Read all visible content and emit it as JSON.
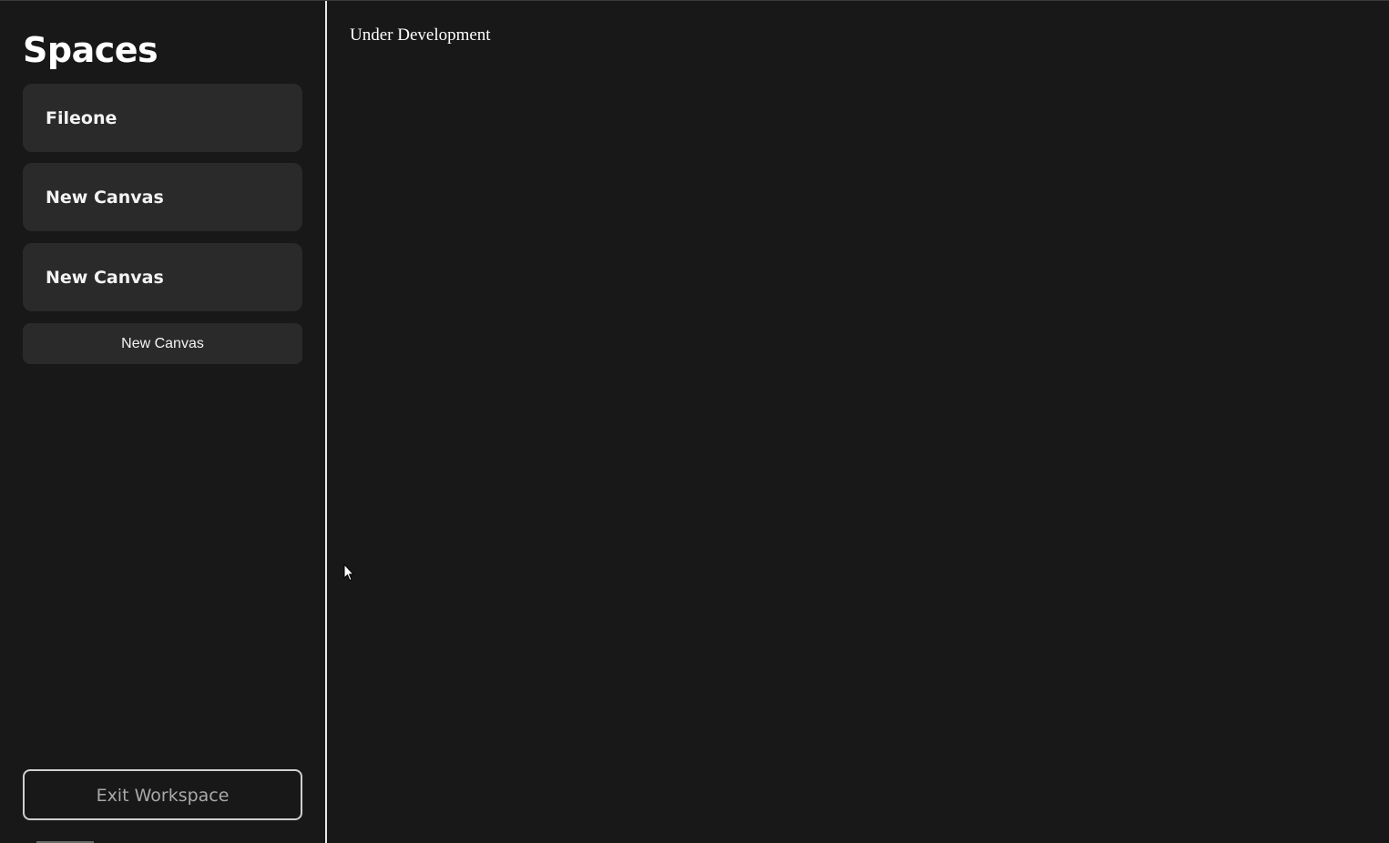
{
  "sidebar": {
    "title": "Spaces",
    "items": [
      {
        "label": "Fileone"
      },
      {
        "label": "New Canvas"
      },
      {
        "label": "New Canvas"
      }
    ],
    "new_canvas_label": "New Canvas",
    "exit_label": "Exit Workspace"
  },
  "main": {
    "message": "Under Development"
  },
  "icons": {
    "cursor": "mouse-pointer-icon"
  },
  "colors": {
    "background": "#181819",
    "card": "#2a2a2b",
    "divider": "#e9e9e9",
    "text": "#ffffff",
    "muted_text": "#a9a9a9"
  }
}
